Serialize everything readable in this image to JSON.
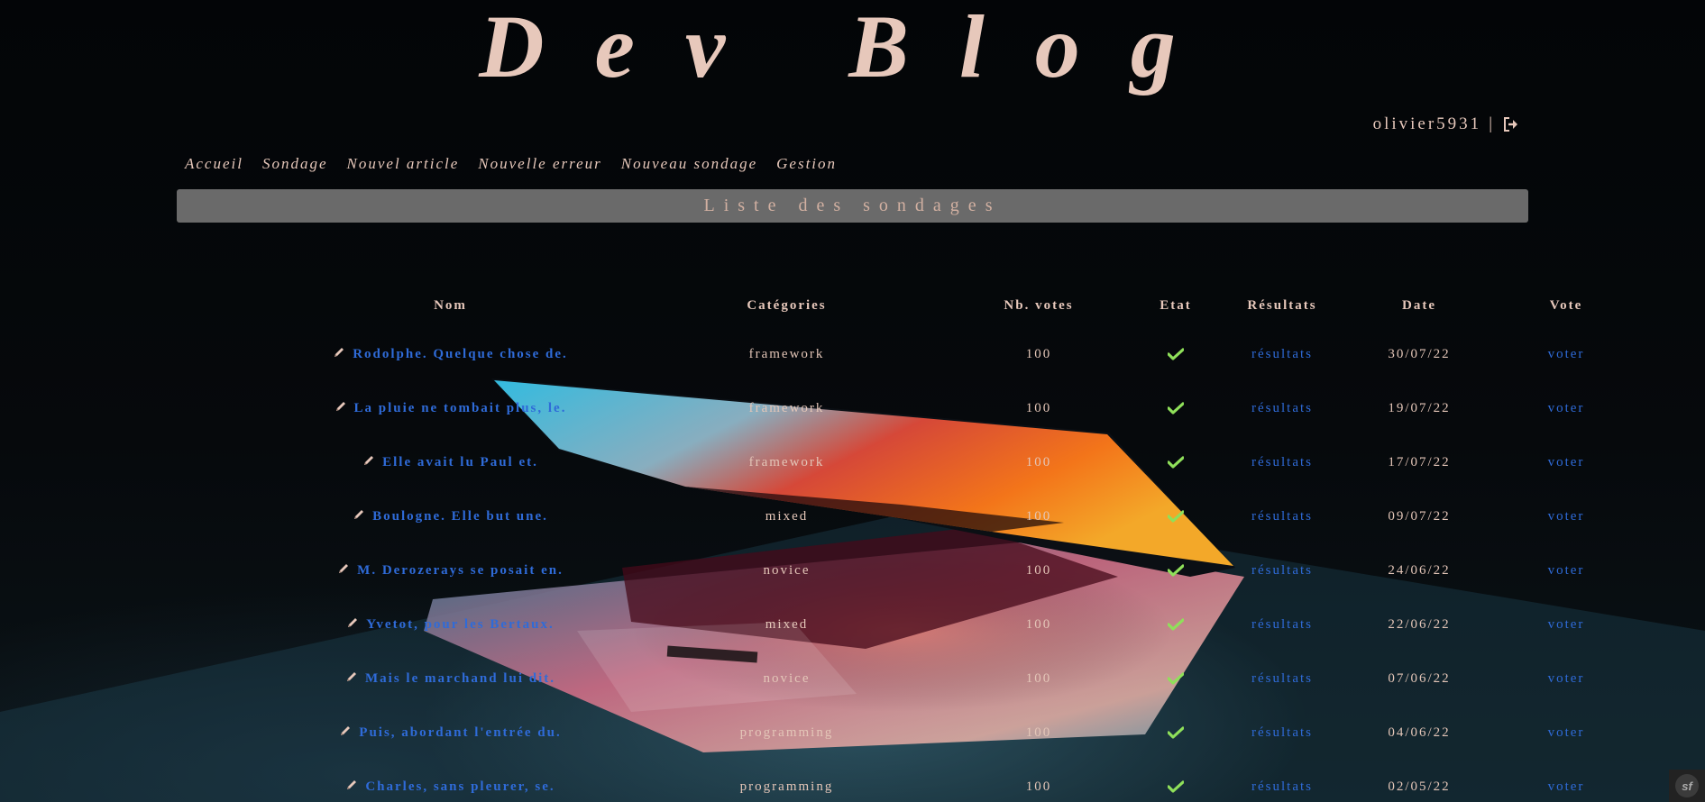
{
  "site": {
    "title": "Dev Blog"
  },
  "user": {
    "username": "olivier5931",
    "separator": "|",
    "logout_icon": "sign-out-icon"
  },
  "nav": [
    {
      "label": "Accueil"
    },
    {
      "label": "Sondage"
    },
    {
      "label": "Nouvel article"
    },
    {
      "label": "Nouvelle erreur"
    },
    {
      "label": "Nouveau sondage"
    },
    {
      "label": "Gestion"
    }
  ],
  "banner": {
    "title": "Liste des sondages"
  },
  "table": {
    "headers": [
      "Nom",
      "Catégories",
      "Nb. votes",
      "Etat",
      "Résultats",
      "Date",
      "Vote"
    ],
    "rows": [
      {
        "name": "Rodolphe. Quelque chose de.",
        "category": "framework",
        "votes": "100",
        "state": "check-icon",
        "results": "résultats",
        "date": "30/07/22",
        "vote": "voter"
      },
      {
        "name": "La pluie ne tombait plus, le.",
        "category": "framework",
        "votes": "100",
        "state": "check-icon",
        "results": "résultats",
        "date": "19/07/22",
        "vote": "voter"
      },
      {
        "name": "Elle avait lu Paul et.",
        "category": "framework",
        "votes": "100",
        "state": "check-icon",
        "results": "résultats",
        "date": "17/07/22",
        "vote": "voter"
      },
      {
        "name": "Boulogne. Elle but une.",
        "category": "mixed",
        "votes": "100",
        "state": "check-icon",
        "results": "résultats",
        "date": "09/07/22",
        "vote": "voter"
      },
      {
        "name": "M. Derozerays se posait en.",
        "category": "novice",
        "votes": "100",
        "state": "check-icon",
        "results": "résultats",
        "date": "24/06/22",
        "vote": "voter"
      },
      {
        "name": "Yvetot, pour les Bertaux.",
        "category": "mixed",
        "votes": "100",
        "state": "check-icon",
        "results": "résultats",
        "date": "22/06/22",
        "vote": "voter"
      },
      {
        "name": "Mais le marchand lui dit.",
        "category": "novice",
        "votes": "100",
        "state": "check-icon",
        "results": "résultats",
        "date": "07/06/22",
        "vote": "voter"
      },
      {
        "name": "Puis, abordant l'entrée du.",
        "category": "programming",
        "votes": "100",
        "state": "check-icon",
        "results": "résultats",
        "date": "04/06/22",
        "vote": "voter"
      },
      {
        "name": "Charles, sans pleurer, se.",
        "category": "programming",
        "votes": "100",
        "state": "check-icon",
        "results": "résultats",
        "date": "02/05/22",
        "vote": "voter"
      }
    ]
  },
  "toolbar": {
    "logo": "sf"
  },
  "colors": {
    "accent_link": "#2f6bd8",
    "text": "#e7c8bb",
    "check": "#8fe05a",
    "banner_bg": "#6a6a6a"
  }
}
